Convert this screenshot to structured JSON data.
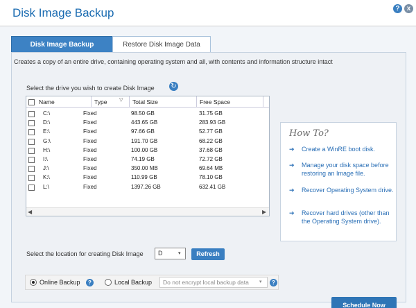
{
  "window": {
    "title": "Disk Image Backup"
  },
  "tabs": [
    {
      "label": "Disk Image Backup"
    },
    {
      "label": "Restore Disk Image Data"
    }
  ],
  "description": "Creates a copy of an entire drive, containing operating system and all, with contents and information structure intact",
  "drive_select_label": "Select the drive you wish to create Disk Image",
  "table": {
    "headers": [
      "Name",
      "Type",
      "Total Size",
      "Free Space"
    ],
    "rows": [
      {
        "name": "C:\\",
        "type": "Fixed",
        "total": "98.50 GB",
        "free": "31.75 GB"
      },
      {
        "name": "D:\\",
        "type": "Fixed",
        "total": "443.65 GB",
        "free": "283.93 GB"
      },
      {
        "name": "E:\\",
        "type": "Fixed",
        "total": "97.66 GB",
        "free": "52.77 GB"
      },
      {
        "name": "G:\\",
        "type": "Fixed",
        "total": "191.70 GB",
        "free": "68.22 GB"
      },
      {
        "name": "H:\\",
        "type": "Fixed",
        "total": "100.00 GB",
        "free": "37.68 GB"
      },
      {
        "name": "I:\\",
        "type": "Fixed",
        "total": "74.19 GB",
        "free": "72.72 GB"
      },
      {
        "name": "J:\\",
        "type": "Fixed",
        "total": "350.00 MB",
        "free": "69.64 MB"
      },
      {
        "name": "K:\\",
        "type": "Fixed",
        "total": "110.99 GB",
        "free": "78.10 GB"
      },
      {
        "name": "L:\\",
        "type": "Fixed",
        "total": "1397.26 GB",
        "free": "632.41 GB"
      }
    ]
  },
  "howto": {
    "title": "How To?",
    "items": [
      "Create a WinRE boot disk.",
      "Manage your disk space before restoring an Image file.",
      "Recover Operating System drive.",
      "Recover hard drives (other than the Operating System drive)."
    ]
  },
  "location": {
    "label": "Select the location for creating Disk Image",
    "selected": "D",
    "refresh_label": "Refresh"
  },
  "backup": {
    "online_label": "Online Backup",
    "local_label": "Local Backup",
    "encrypt_placeholder": "Do not encrypt local backup data",
    "selected": "online"
  },
  "schedule_label": "Schedule Now",
  "icons": {
    "help": "?",
    "close": "x",
    "refresh": "↻",
    "arrow": "➔",
    "dropdown": "▾",
    "scroll_left": "◀",
    "scroll_right": "▶"
  },
  "colors": {
    "accent": "#3a7fc1",
    "title": "#1a6bb1",
    "link": "#2a6fb6"
  }
}
